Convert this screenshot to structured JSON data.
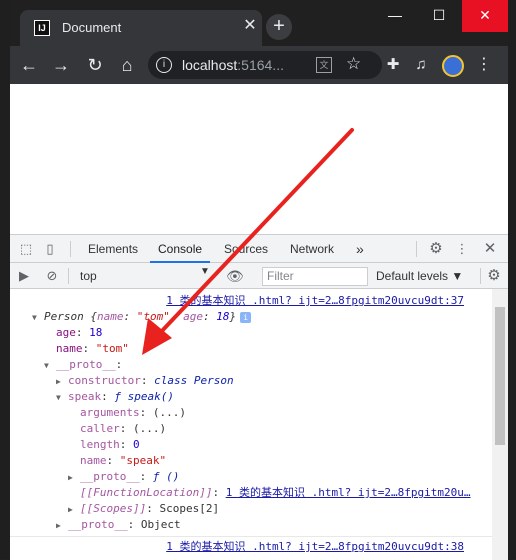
{
  "browser": {
    "tab_title": "Document",
    "favicon_text": "IJ",
    "url_host": "localhost",
    "url_rest": ":5164...",
    "translate_glyph": "文",
    "new_tab": "+",
    "win_min": "—",
    "win_max": "☐",
    "win_close": "✕",
    "back": "←",
    "forward": "→",
    "reload": "↻",
    "home": "⌂",
    "info": "i",
    "star": "☆",
    "extensions": "✚",
    "media": "♫",
    "menu": "⋮"
  },
  "devtools": {
    "tabs": [
      "Elements",
      "Console",
      "Sources",
      "Network"
    ],
    "active_tab": "Console",
    "more_tabs": "»",
    "context": "top",
    "filter_placeholder": "Filter",
    "levels": "Default levels ▼"
  },
  "console": {
    "src1": "1 类的基本知识 .html? ijt=2…8fpgitm20uvcu9dt:37",
    "src2": "1 类的基本知识 .html? ijt=2…8fpgitm20uvcu9dt:38",
    "obj_summary_prefix": "Person {",
    "obj_name_key": "name",
    "obj_name_val": "\"tom\"",
    "obj_age_key": "age",
    "obj_age_val": "18",
    "obj_summary_suffix": "}",
    "age_key": "age",
    "age_val": "18",
    "name_key": "name",
    "name_val": "\"tom\"",
    "proto_key": "__proto__",
    "constructor_key": "constructor",
    "constructor_val": "class Person",
    "speak_key": "speak",
    "speak_val": "ƒ speak()",
    "arguments_key": "arguments",
    "arguments_val": "(...)",
    "caller_key": "caller",
    "caller_val": "(...)",
    "length_key": "length",
    "length_val": "0",
    "fname_key": "name",
    "fname_val": "\"speak\"",
    "inner_proto_key": "__proto__",
    "inner_proto_val": "ƒ ()",
    "fnloc_key": "[[FunctionLocation]]",
    "fnloc_val": "1 类的基本知识 .html? ijt=2…8fpgitm20u…",
    "scopes_key": "[[Scopes]]",
    "scopes_val": "Scopes[2]",
    "outer_proto_key": "__proto__",
    "outer_proto_val": "Object"
  },
  "colors": {
    "annotation_arrow": "#e8231f",
    "accent": "#1a73e8"
  }
}
